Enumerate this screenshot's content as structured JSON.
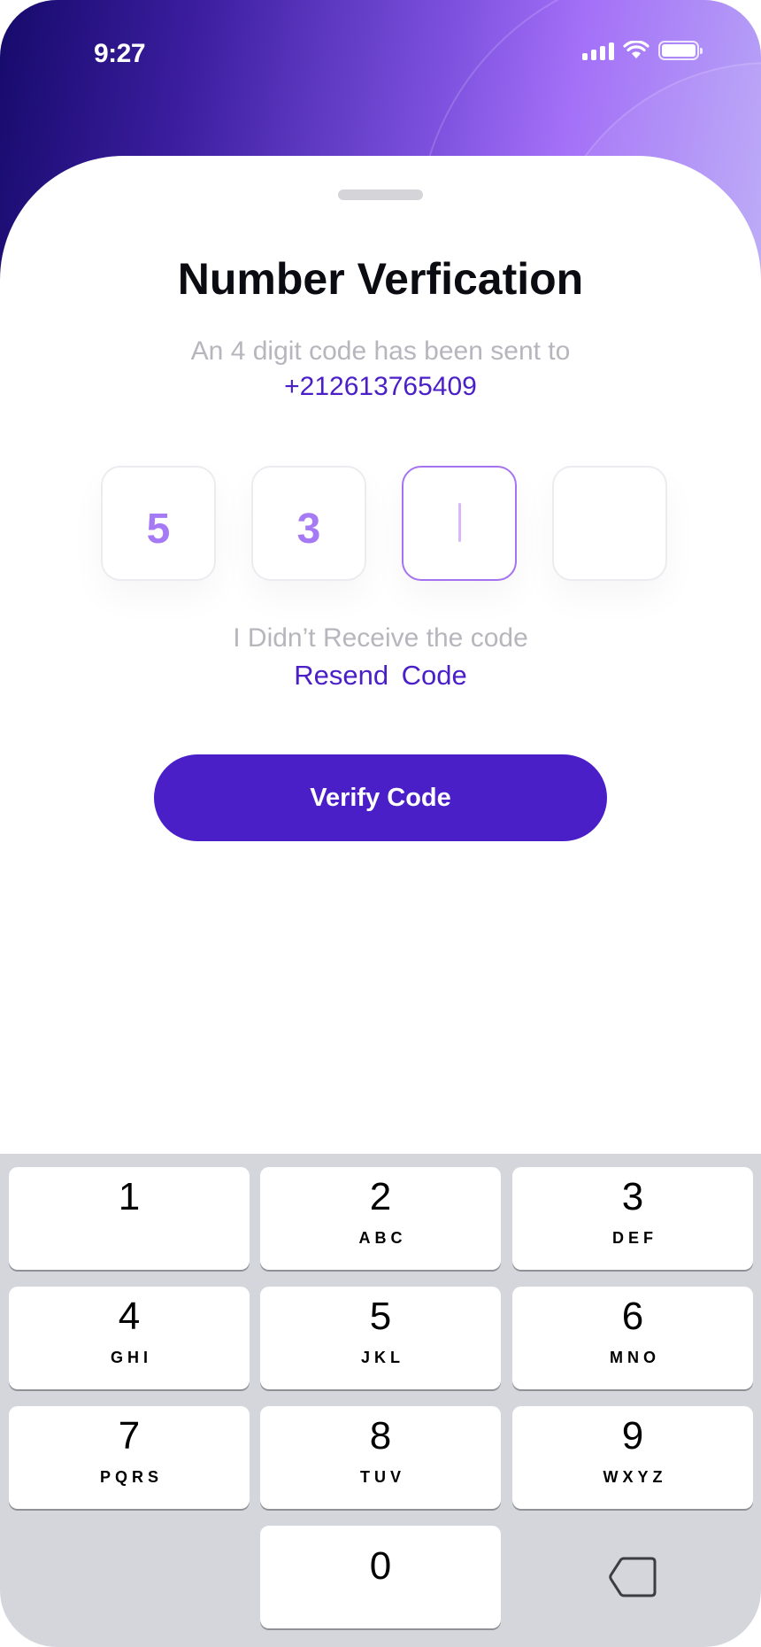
{
  "status_bar": {
    "time": "9:27",
    "icons": [
      "signal-icon",
      "wifi-icon",
      "battery-icon"
    ]
  },
  "verification": {
    "title": "Number Verfication",
    "subtitle": "An 4 digit code has been sent to",
    "phone_number": "+212613765409",
    "digits": [
      "5",
      "3",
      "",
      ""
    ],
    "active_index": 2,
    "no_code_text": "I Didn’t Receive the code",
    "resend_label": "Resend  Code",
    "verify_label": "Verify Code"
  },
  "keypad": {
    "keys": [
      {
        "num": "1",
        "letters": ""
      },
      {
        "num": "2",
        "letters": "ABC"
      },
      {
        "num": "3",
        "letters": "DEF"
      },
      {
        "num": "4",
        "letters": "GHI"
      },
      {
        "num": "5",
        "letters": "JKL"
      },
      {
        "num": "6",
        "letters": "MNO"
      },
      {
        "num": "7",
        "letters": "PQRS"
      },
      {
        "num": "8",
        "letters": "TUV"
      },
      {
        "num": "9",
        "letters": "WXYZ"
      },
      {
        "num": "0",
        "letters": ""
      }
    ],
    "delete_icon": "backspace-icon"
  },
  "colors": {
    "accent": "#4a1fc8",
    "digit": "#a77af5",
    "muted": "#b6b6bd",
    "keypad_bg": "#d4d6dc"
  }
}
